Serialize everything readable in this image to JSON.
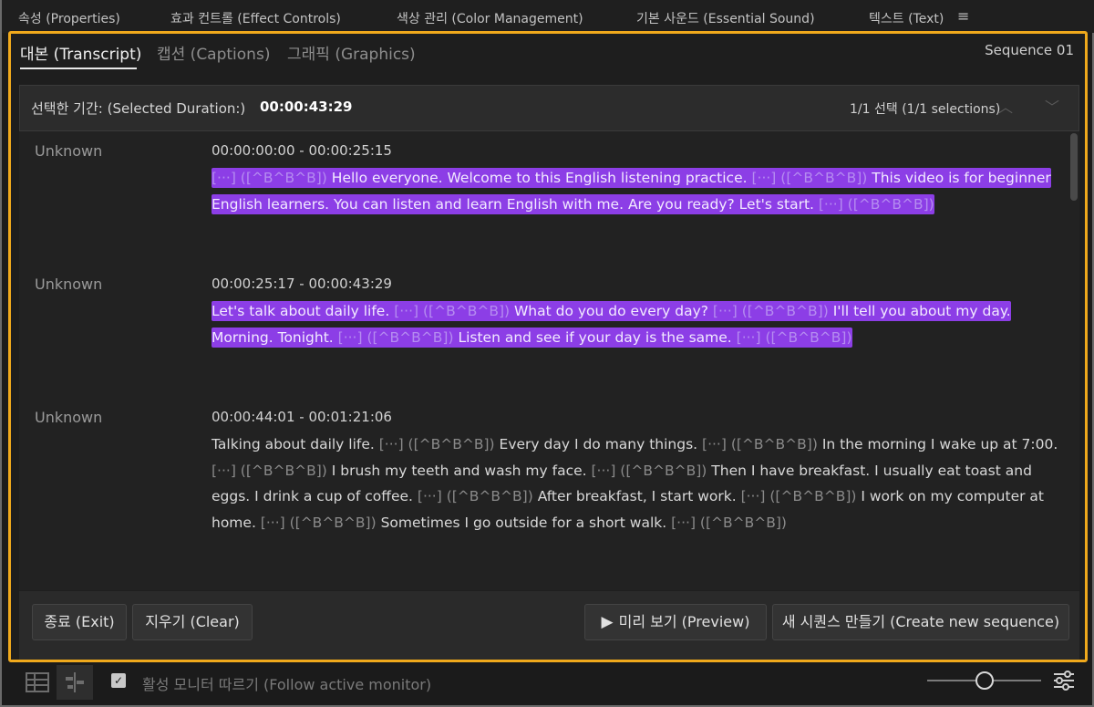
{
  "panel_tabs": [
    "속성 (Properties)",
    "효과 컨트롤 (Effect Controls)",
    "색상 관리 (Color Management)",
    "기본 사운드 (Essential Sound)",
    "텍스트 (Text)"
  ],
  "panel_menu_icon": "hamburger-menu-icon",
  "subtabs": {
    "transcript": "대본 (Transcript)",
    "captions": "캡션 (Captions)",
    "graphics": "그래픽 (Graphics)",
    "sequence": "Sequence 01"
  },
  "duration": {
    "label": "선택한 기간: (Selected Duration:)",
    "value": "00:00:43:29",
    "selection_count": "1/1 선택 (1/1 selections)"
  },
  "segments": [
    {
      "speaker": "Unknown",
      "timecode": "00:00:00:00 - 00:00:25:15",
      "selected": true,
      "parts": [
        {
          "t": "[···] ([^B^B^B])",
          "pause": true
        },
        {
          "t": " Hello everyone. Welcome to this English listening practice. ",
          "pause": false
        },
        {
          "t": "[···] ([^B^B^B])",
          "pause": true
        },
        {
          "t": " This video is for beginner English learners. You can listen and learn English with me. Are you ready? Let's start. ",
          "pause": false
        },
        {
          "t": "[···] ([^B^B^B])",
          "pause": true
        }
      ]
    },
    {
      "speaker": "Unknown",
      "timecode": "00:00:25:17 - 00:00:43:29",
      "selected": true,
      "parts": [
        {
          "t": "Let's talk about daily life. ",
          "pause": false
        },
        {
          "t": "[···] ([^B^B^B])",
          "pause": true
        },
        {
          "t": " What do you do every day? ",
          "pause": false
        },
        {
          "t": "[···] ([^B^B^B])",
          "pause": true
        },
        {
          "t": " I'll tell you about my day. Morning. Tonight. ",
          "pause": false
        },
        {
          "t": "[···] ([^B^B^B])",
          "pause": true
        },
        {
          "t": " Listen and see if your day is the same. ",
          "pause": false
        },
        {
          "t": "[···] ([^B^B^B])",
          "pause": true
        }
      ]
    },
    {
      "speaker": "Unknown",
      "timecode": "00:00:44:01 - 00:01:21:06",
      "selected": false,
      "parts": [
        {
          "t": "Talking about daily life. ",
          "pause": false
        },
        {
          "t": "[···] ([^B^B^B])",
          "pause": true
        },
        {
          "t": " Every day I do many things. ",
          "pause": false
        },
        {
          "t": "[···] ([^B^B^B])",
          "pause": true
        },
        {
          "t": " In the morning I wake up at 7:00. ",
          "pause": false
        },
        {
          "t": "[···] ([^B^B^B])",
          "pause": true
        },
        {
          "t": " I brush my teeth and wash my face. ",
          "pause": false
        },
        {
          "t": "[···] ([^B^B^B])",
          "pause": true
        },
        {
          "t": " Then I have breakfast. I usually eat toast and eggs. I drink a cup of coffee. ",
          "pause": false
        },
        {
          "t": "[···] ([^B^B^B])",
          "pause": true
        },
        {
          "t": " After breakfast, I start work. ",
          "pause": false
        },
        {
          "t": "[···] ([^B^B^B])",
          "pause": true
        },
        {
          "t": " I work on my computer at home. ",
          "pause": false
        },
        {
          "t": "[···] ([^B^B^B])",
          "pause": true
        },
        {
          "t": " Sometimes I go outside for a short walk. ",
          "pause": false
        },
        {
          "t": "[···] ([^B^B^B])",
          "pause": true
        }
      ]
    }
  ],
  "buttons": {
    "exit": "종료 (Exit)",
    "clear": "지우기 (Clear)",
    "preview": "미리 보기 (Preview)",
    "create_sequence": "새 시퀀스 만들기 (Create new sequence)"
  },
  "footer": {
    "follow_monitor": "활성 모니터 따르기 (Follow active monitor)",
    "follow_checked": true
  },
  "colors": {
    "accent_border": "#f0a91c",
    "selection": "#8c3ee6"
  }
}
